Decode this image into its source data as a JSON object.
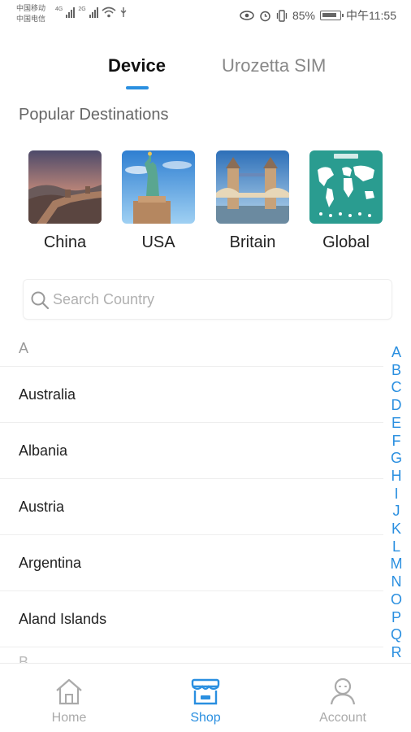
{
  "status_bar": {
    "carrier_1": "中国移动",
    "carrier_2": "中国电信",
    "net_1": "4G",
    "net_2": "2G",
    "battery": "85%",
    "time": "中午11:55"
  },
  "tabs": [
    {
      "label": "Device",
      "active": true
    },
    {
      "label": "Urozetta SIM",
      "active": false
    }
  ],
  "popular_title": "Popular Destinations",
  "destinations": [
    {
      "name": "China",
      "image": "great-wall"
    },
    {
      "name": "USA",
      "image": "statue-of-liberty"
    },
    {
      "name": "Britain",
      "image": "tower-bridge"
    },
    {
      "name": "Global",
      "image": "world-map"
    }
  ],
  "search": {
    "placeholder": "Search Country",
    "value": ""
  },
  "list": {
    "section_a": "A",
    "section_b": "B",
    "countries": [
      "Australia",
      "Albania",
      "Austria",
      "Argentina",
      "Aland Islands"
    ]
  },
  "index_letters": [
    "A",
    "B",
    "C",
    "D",
    "E",
    "F",
    "G",
    "H",
    "I",
    "J",
    "K",
    "L",
    "M",
    "N",
    "O",
    "P",
    "Q",
    "R"
  ],
  "bottom_nav": [
    {
      "label": "Home",
      "icon": "home-icon",
      "active": false
    },
    {
      "label": "Shop",
      "icon": "shop-icon",
      "active": true
    },
    {
      "label": "Account",
      "icon": "account-icon",
      "active": false
    }
  ],
  "colors": {
    "accent": "#2a8fe0",
    "inactive": "#aaaaaa"
  }
}
